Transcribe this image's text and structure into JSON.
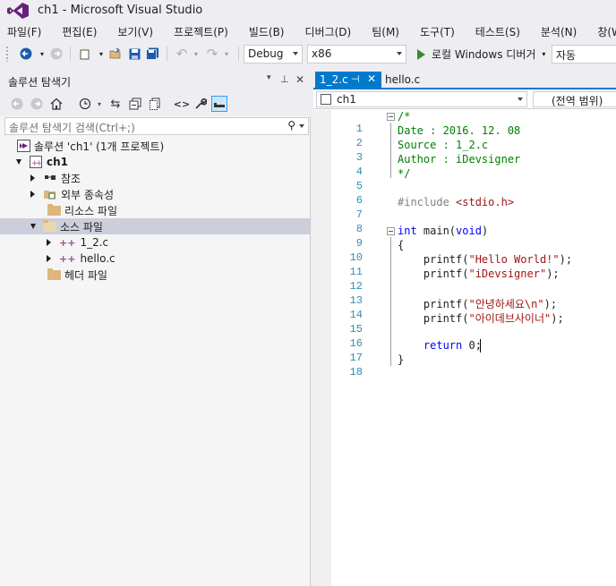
{
  "window": {
    "title": "ch1 - Microsoft Visual Studio"
  },
  "menu": [
    "파일(F)",
    "편집(E)",
    "보기(V)",
    "프로젝트(P)",
    "빌드(B)",
    "디버그(D)",
    "팀(M)",
    "도구(T)",
    "테스트(S)",
    "분석(N)",
    "창(W)"
  ],
  "toolbar": {
    "config": "Debug",
    "platform": "x86",
    "run_label": "로컬 Windows 디버거",
    "run_mode": "자동"
  },
  "solution_explorer": {
    "title": "솔루션 탐색기",
    "search_placeholder": "솔루션 탐색기 검색(Ctrl+;)",
    "tree": [
      {
        "label": "솔루션 'ch1' (1개 프로젝트)",
        "icon": "solution-icon"
      },
      {
        "label": "ch1",
        "icon": "project-icon"
      },
      {
        "label": "참조",
        "icon": "references-icon"
      },
      {
        "label": "외부 종속성",
        "icon": "external-deps-icon"
      },
      {
        "label": "리소스 파일",
        "icon": "folder-icon"
      },
      {
        "label": "소스 파일",
        "icon": "folder-icon"
      },
      {
        "label": "1_2.c",
        "icon": "cpp-file-icon"
      },
      {
        "label": "hello.c",
        "icon": "cpp-file-icon"
      },
      {
        "label": "헤더 파일",
        "icon": "folder-icon"
      }
    ]
  },
  "editor": {
    "tabs": [
      {
        "label": "1_2.c",
        "active": true
      },
      {
        "label": "hello.c",
        "active": false
      }
    ],
    "nav_project": "ch1",
    "nav_scope": "(전역 범위)",
    "lines": [
      {
        "num": "1",
        "text": "/*"
      },
      {
        "num": "2",
        "text": "Date : 2016. 12. 08"
      },
      {
        "num": "3",
        "text": "Source : 1_2.c"
      },
      {
        "num": "4",
        "text": "Author : iDevsigner"
      },
      {
        "num": "5",
        "text": "*/"
      },
      {
        "num": "6",
        "text": ""
      },
      {
        "num": "7",
        "text_pre": "#include ",
        "text_str": "<stdio.h>"
      },
      {
        "num": "8",
        "text": ""
      },
      {
        "num": "9",
        "text_kw": "int",
        "text_rest": " main(",
        "text_kw2": "void",
        "text_end": ")"
      },
      {
        "num": "10",
        "text": "{"
      },
      {
        "num": "11",
        "text_a": "    printf(",
        "text_str": "\"Hello World!\"",
        "text_b": ");"
      },
      {
        "num": "12",
        "text_a": "    printf(",
        "text_str": "\"iDevsigner\"",
        "text_b": ");"
      },
      {
        "num": "13",
        "text": ""
      },
      {
        "num": "14",
        "text_a": "    printf(",
        "text_str": "\"안녕하세요\\n\"",
        "text_b": ");"
      },
      {
        "num": "15",
        "text_a": "    printf(",
        "text_str": "\"아이데브사이너\"",
        "text_b": ");"
      },
      {
        "num": "16",
        "text": ""
      },
      {
        "num": "17",
        "text_kw": "    return",
        "text_rest": " 0;"
      },
      {
        "num": "18",
        "text": "}"
      }
    ]
  },
  "colors": {
    "accent": "#007acc",
    "comment": "#008000",
    "string": "#a31515",
    "keyword": "#0000ff",
    "linenum": "#2b91af",
    "vs_purple": "#68217a"
  }
}
